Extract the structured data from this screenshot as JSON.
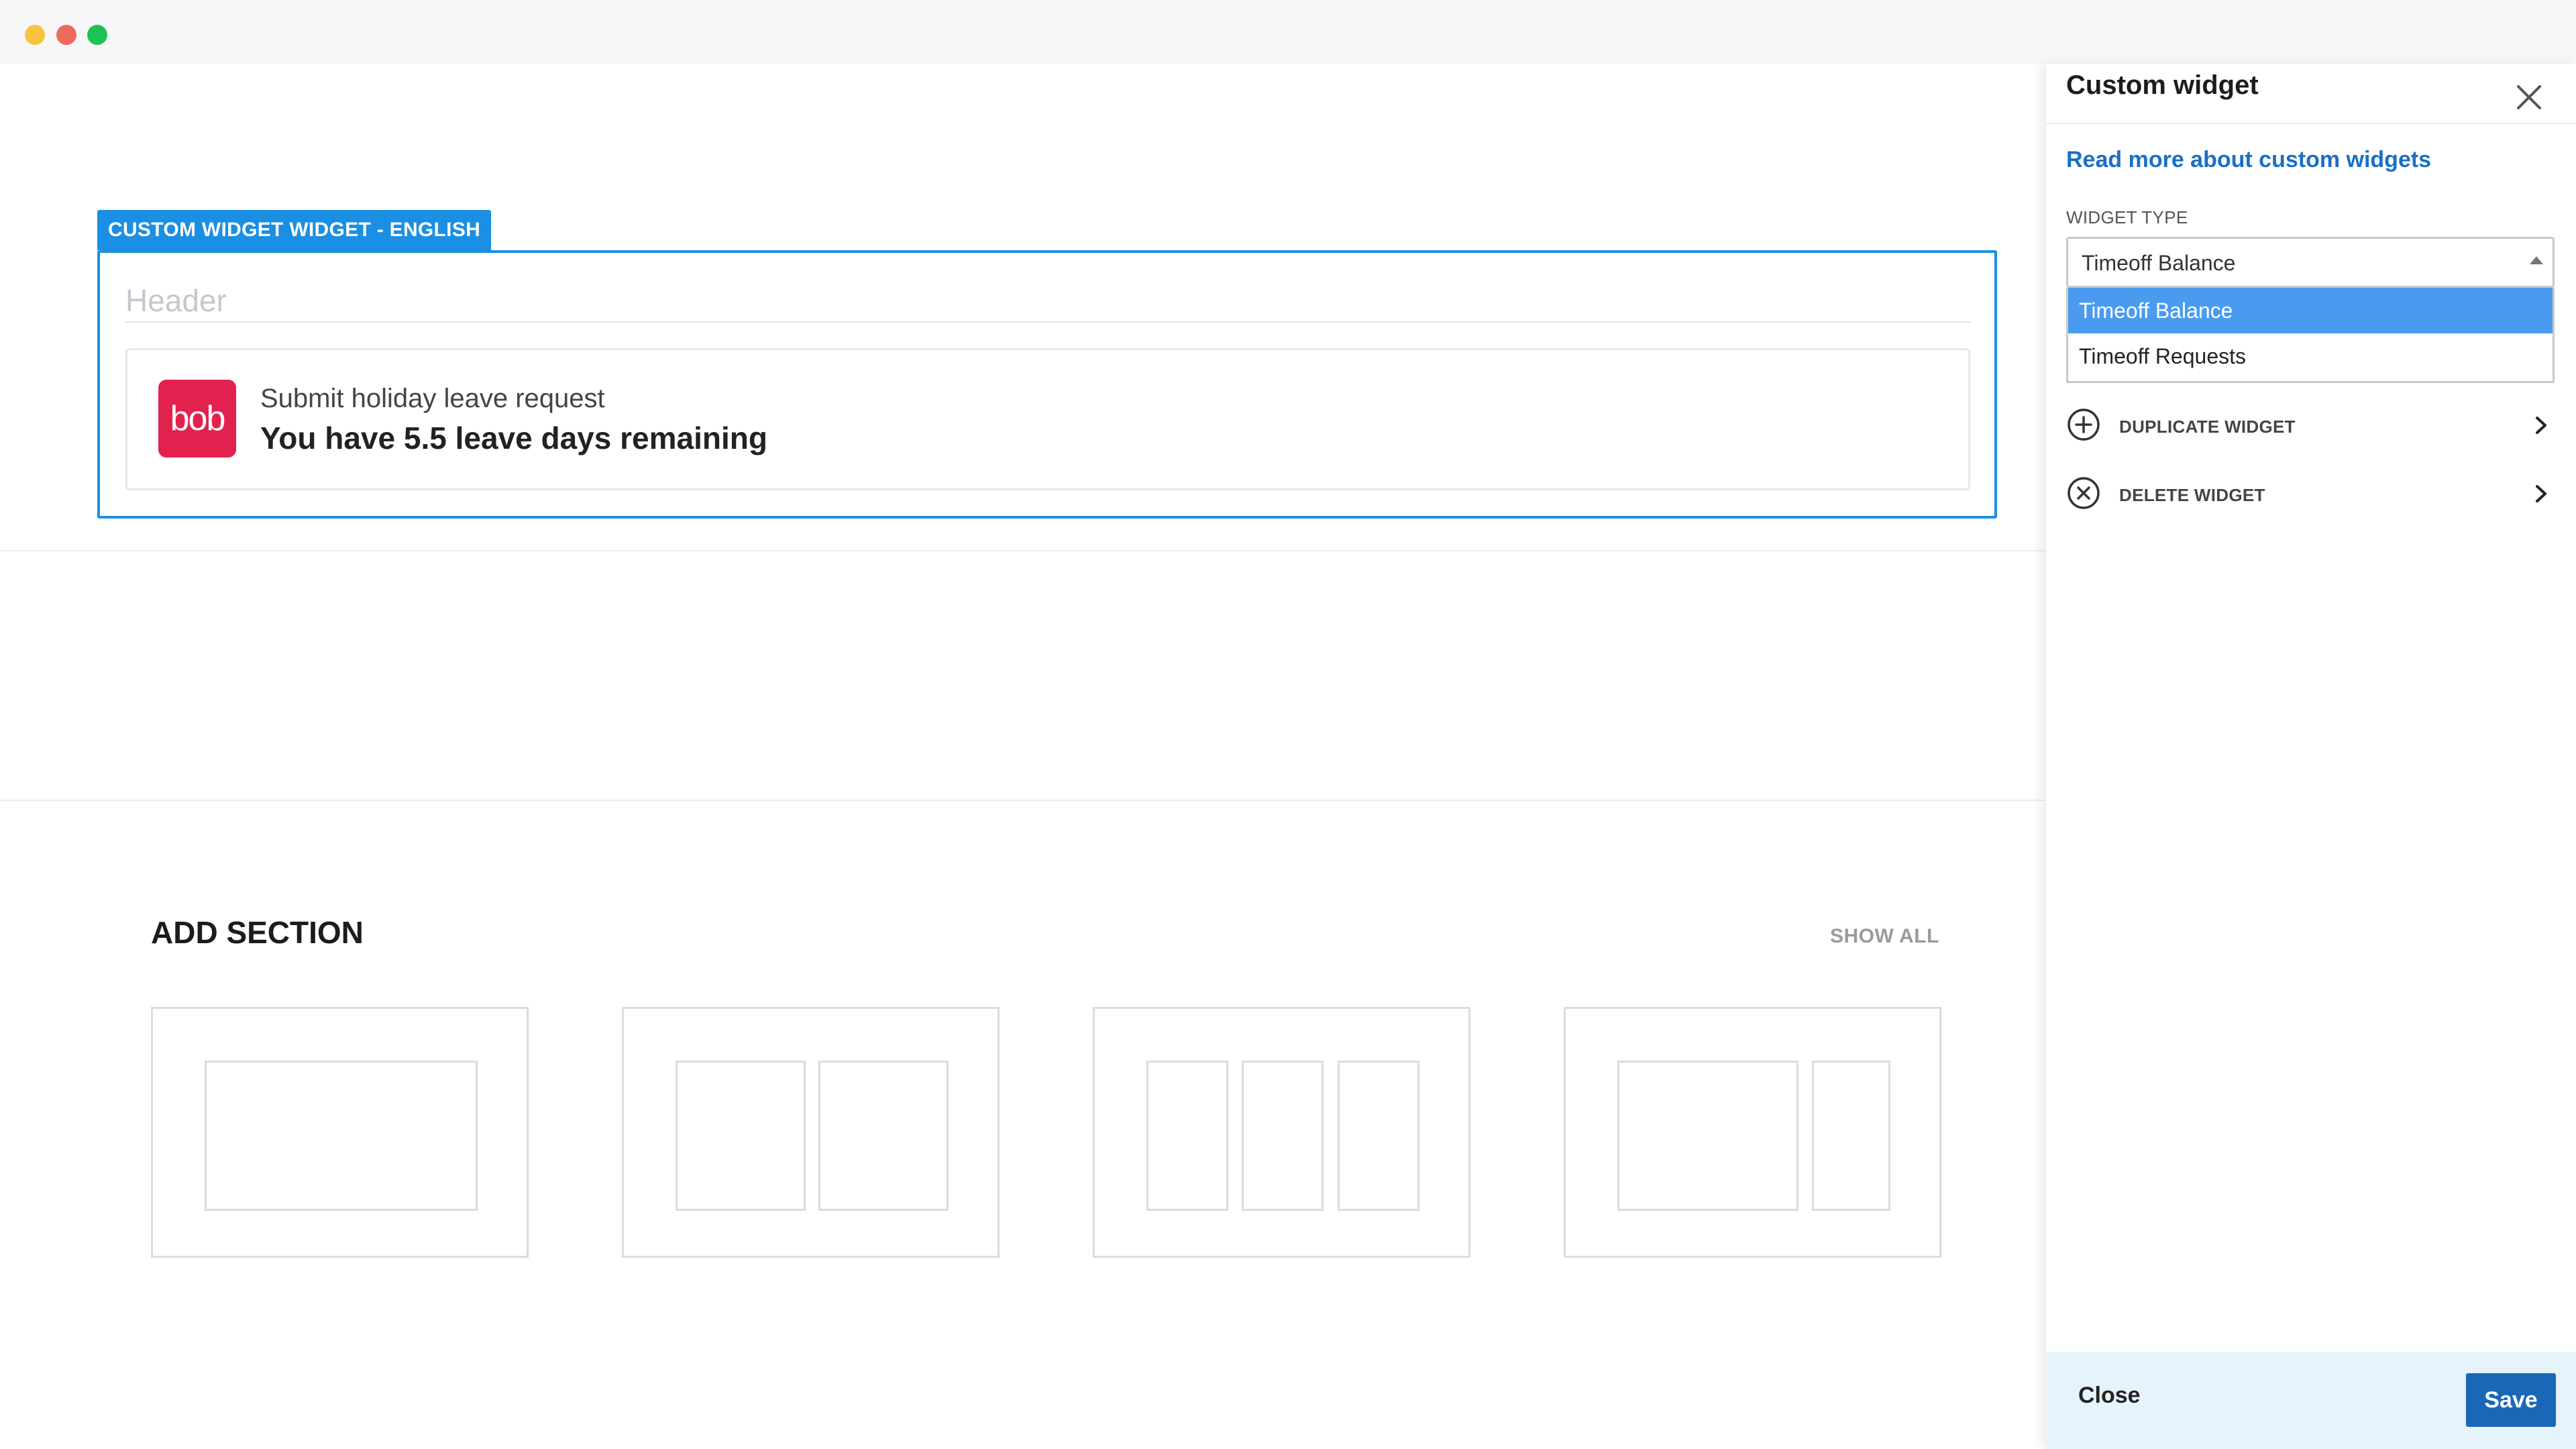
{
  "window": {
    "controls": [
      "minimize",
      "close",
      "maximize"
    ]
  },
  "widget": {
    "tag_label": "CUSTOM WIDGET WIDGET - ENGLISH",
    "header_placeholder": "Header",
    "card": {
      "logo_text": "bob",
      "subtitle": "Submit holiday leave request",
      "title": "You have 5.5 leave days remaining"
    }
  },
  "add_section": {
    "title": "ADD SECTION",
    "show_all": "SHOW ALL",
    "layouts": [
      "1-column",
      "2-column",
      "3-column",
      "2/3 + 1/3"
    ]
  },
  "panel": {
    "title": "Custom widget",
    "read_more": "Read more about custom widgets",
    "widget_type_label": "WIDGET TYPE",
    "selected_value": "Timeoff Balance",
    "options": [
      {
        "label": "Timeoff Balance",
        "selected": true
      },
      {
        "label": "Timeoff Requests",
        "selected": false
      }
    ],
    "actions": [
      {
        "label": "DUPLICATE WIDGET",
        "icon": "plus-circle-icon"
      },
      {
        "label": "DELETE WIDGET",
        "icon": "x-circle-icon"
      }
    ],
    "footer": {
      "close_label": "Close",
      "save_label": "Save"
    }
  },
  "colors": {
    "accent": "#1a8fe3",
    "brand_logo": "#e3214f",
    "save_button": "#1a67b8",
    "footer_bg": "#e5f3fb",
    "option_selected": "#4a9bf0"
  }
}
